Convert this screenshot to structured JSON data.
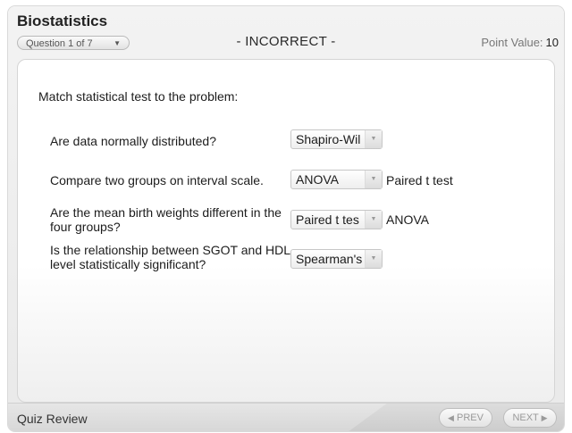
{
  "header": {
    "title": "Biostatistics",
    "question_selector": "Question 1 of 7",
    "status": "- INCORRECT -",
    "point_label": "Point Value:",
    "point_value": "10"
  },
  "content": {
    "instruction": "Match statistical test to the problem:",
    "rows": [
      {
        "question": "Are data normally distributed?",
        "selected": "Shapiro-Wil",
        "answer": ""
      },
      {
        "question": "Compare two groups on interval scale.",
        "selected": "ANOVA",
        "answer": "Paired t test"
      },
      {
        "question": "Are the mean birth weights different in the four groups?",
        "selected": "Paired t tes",
        "answer": "ANOVA"
      },
      {
        "question": "Is the relationship between SGOT and HDL level  statistically significant?",
        "selected": "Spearman's",
        "answer": ""
      }
    ]
  },
  "footer": {
    "label": "Quiz Review",
    "prev_label": "PREV",
    "next_label": "NEXT"
  },
  "icons": {
    "dropdown_caret": "▾",
    "prev_arrow": "◀",
    "next_arrow": "▶"
  }
}
